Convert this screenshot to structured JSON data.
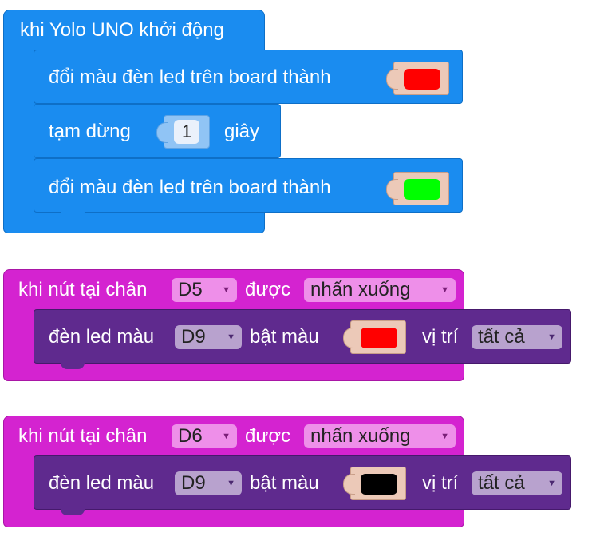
{
  "startup": {
    "title": "khi Yolo UNO khởi động",
    "steps": {
      "led1_label": "đổi màu đèn led trên board thành",
      "led1_color": "#ff0000",
      "pause_label": "tạm dừng",
      "pause_value": "1",
      "pause_unit": "giây",
      "led2_label": "đổi màu đèn led trên board thành",
      "led2_color": "#00ff00"
    }
  },
  "button_blocks": [
    {
      "prefix": "khi nút tại chân",
      "pin": "D5",
      "mid": "được",
      "action": "nhấn xuống",
      "body": {
        "label": "đèn led màu",
        "led_pin": "D9",
        "on_label": "bật màu",
        "color": "#ff0000",
        "pos_label": "vị trí",
        "pos_value": "tất cả"
      }
    },
    {
      "prefix": "khi nút tại chân",
      "pin": "D6",
      "mid": "được",
      "action": "nhấn xuống",
      "body": {
        "label": "đèn led màu",
        "led_pin": "D9",
        "on_label": "bật màu",
        "color": "#000000",
        "pos_label": "vị trí",
        "pos_value": "tất cả"
      }
    }
  ],
  "icons": {
    "dropdown": "chevron-down-icon"
  }
}
